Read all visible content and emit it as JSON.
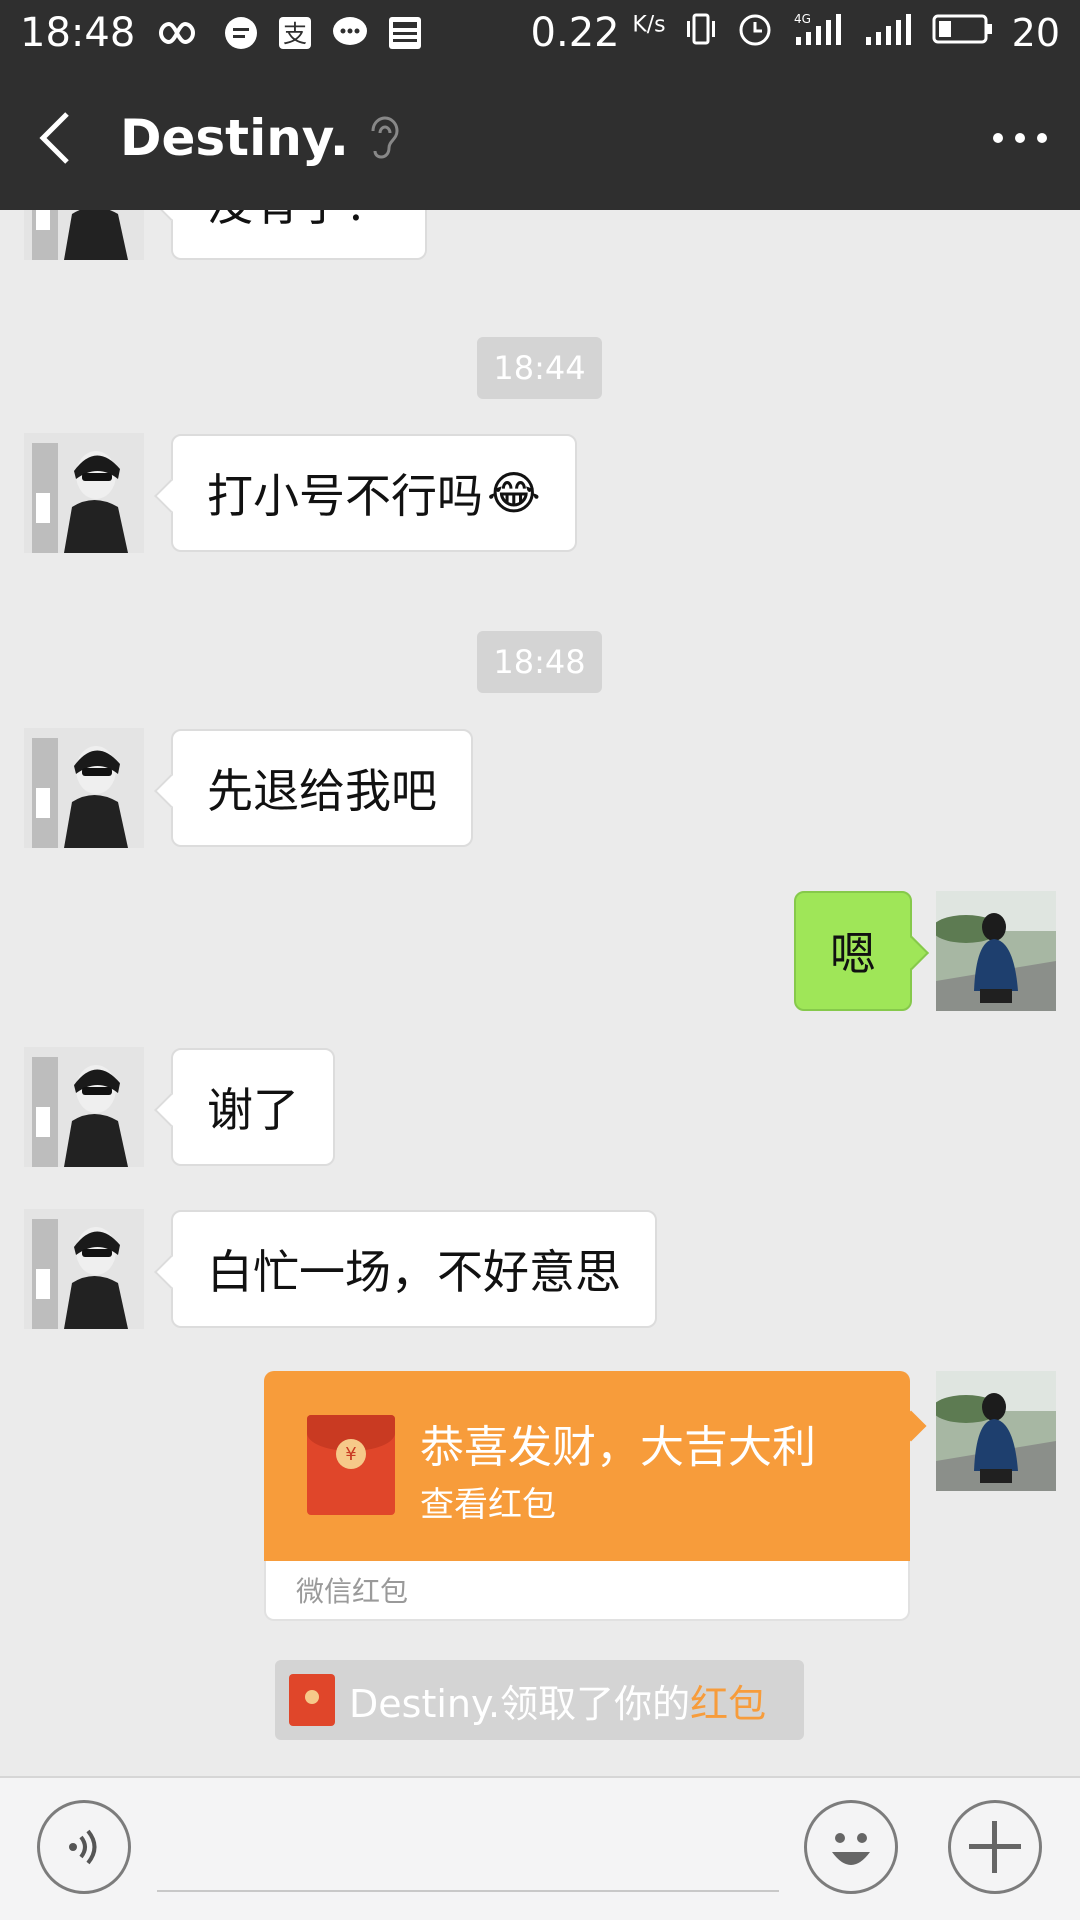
{
  "status_bar": {
    "time": "18:48",
    "speed_value": "0.22",
    "speed_unit": "K/s",
    "network": "4G",
    "battery": "20"
  },
  "header": {
    "title": "Destiny.",
    "icons": [
      "back-arrow-icon",
      "ear-icon",
      "more-icon"
    ]
  },
  "messages": {
    "partial_top": "没有了？",
    "ts1": "18:44",
    "m1": "打小号不行吗",
    "m1_emoji": "😂",
    "ts2": "18:48",
    "m2": "先退给我吧",
    "m3": "嗯",
    "m4": "谢了",
    "m5": "白忙一场，不好意思"
  },
  "red_packet": {
    "greeting": "恭喜发财，大吉大利",
    "action": "查看红包",
    "brand": "微信红包"
  },
  "notice": {
    "prefix": "Destiny.领取了你的",
    "link": "红包"
  },
  "colors": {
    "nav_bg": "#2f2f2f",
    "chat_bg": "#ebebeb",
    "sent_bubble": "#9fe658",
    "red_packet": "#f79c3b",
    "accent_orange": "#f79c3b"
  }
}
